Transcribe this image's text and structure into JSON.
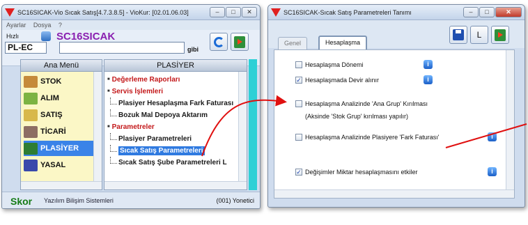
{
  "colors": {
    "accent": "#3a83e8",
    "app_name": "#8a1fb0",
    "skor": "#147a14",
    "group": "#c3181a",
    "cyan": "#2ed0d6",
    "arrow": "#e01010"
  },
  "left_window": {
    "title": "SC16SICAK-Vio Sıcak Satış[4.7.3.8.5] - VioKur: [02.01.06.03]",
    "menu": [
      "Ayarlar",
      "Dosya",
      "?"
    ],
    "speed_label": "Hızlı",
    "app_name": "SC16SICAK",
    "code_value": "PL-EC",
    "gibi_label": "gibi",
    "main_menu_header": "Ana Menü",
    "main_menu_items": [
      {
        "label": "STOK",
        "icon": "stock-icon",
        "color": "#c58a3a"
      },
      {
        "label": "ALIM",
        "icon": "purchase-icon",
        "color": "#7cb342"
      },
      {
        "label": "SATIŞ",
        "icon": "sales-icon",
        "color": "#d8b84a"
      },
      {
        "label": "TİCARİ",
        "icon": "commerce-icon",
        "color": "#8d6e63"
      },
      {
        "label": "PLASİYER",
        "icon": "salesman-icon",
        "color": "#2e7d32"
      },
      {
        "label": "YASAL",
        "icon": "legal-icon",
        "color": "#3949ab"
      }
    ],
    "plasiyer_header": "PLASİYER",
    "tree": [
      {
        "type": "group",
        "label": "Değerleme Raporları"
      },
      {
        "type": "group",
        "label": "Servis İşlemleri"
      },
      {
        "type": "leaf",
        "label": "Plasiyer Hesaplaşma Fark Faturası"
      },
      {
        "type": "leaf",
        "label": "Bozuk Mal Depoya Aktarım"
      },
      {
        "type": "group",
        "label": "Parametreler"
      },
      {
        "type": "leaf",
        "label": "Plasiyer Parametreleri"
      },
      {
        "type": "leaf",
        "label": "Sıcak Satış Parametreleri",
        "selected": true
      },
      {
        "type": "leaf",
        "label": "Sıcak Satış Şube Parametreleri L"
      }
    ],
    "status": {
      "brand": "Skor",
      "company": "Yazılım Bilişim Sistemleri",
      "user": "(001) Yonetici"
    }
  },
  "right_window": {
    "title": "SC16SICAK-Sıcak Satış Parametreleri Tanımı",
    "toolbar": {
      "save_icon": "save-icon",
      "list_label": "L",
      "exit_icon": "exit-icon"
    },
    "tabs": [
      {
        "label": "Genel",
        "active": false
      },
      {
        "label": "Hesaplaşma",
        "active": true
      }
    ],
    "options": [
      {
        "label": "Hesaplaşma Dönemi",
        "checked": false
      },
      {
        "label": "Hesaplaşmada Devir alınır",
        "checked": true
      },
      {
        "label": "Hesaplaşma Analizinde 'Ana Grup' Kırılması",
        "checked": false
      },
      {
        "label": "Hesaplaşma Analizinde Plasiyere 'Fark Faturası'",
        "checked": false
      },
      {
        "label": "Değişimler Miktar hesaplaşmasını etkiler",
        "checked": true
      }
    ],
    "note": "(Aksinde 'Stok Grup' kırılması yapılır)"
  }
}
